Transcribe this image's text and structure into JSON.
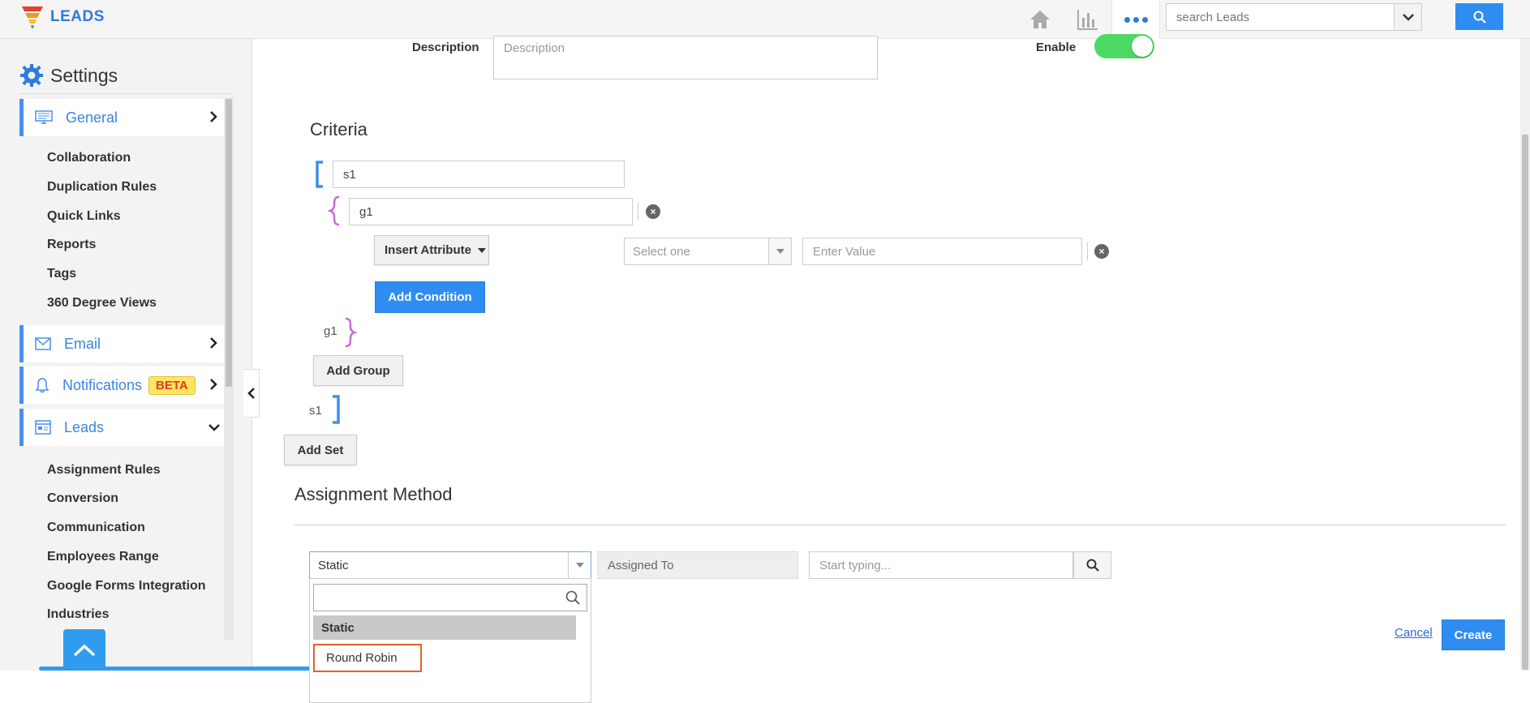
{
  "app": {
    "title": "LEADS"
  },
  "header": {
    "search_placeholder": "search Leads",
    "icons": [
      "home-icon",
      "chart-icon",
      "more-icon",
      "search-icon"
    ]
  },
  "sidebar": {
    "title": "Settings",
    "sections": [
      {
        "label": "General",
        "items": [
          "Collaboration",
          "Duplication Rules",
          "Quick Links",
          "Reports",
          "Tags",
          "360 Degree Views"
        ]
      },
      {
        "label": "Email"
      },
      {
        "label": "Notifications",
        "badge": "BETA"
      },
      {
        "label": "Leads",
        "items": [
          "Assignment Rules",
          "Conversion",
          "Communication",
          "Employees Range",
          "Google Forms Integration",
          "Industries"
        ]
      }
    ]
  },
  "form": {
    "description_label": "Description",
    "description_placeholder": "Description",
    "enable_label": "Enable",
    "enable_on": true
  },
  "criteria": {
    "title": "Criteria",
    "set_name": "s1",
    "group_name": "g1",
    "insert_attribute": "Insert Attribute",
    "select_placeholder": "Select one",
    "value_placeholder": "Enter Value",
    "add_condition": "Add Condition",
    "group_close_label": "g1",
    "add_group": "Add Group",
    "set_close_label": "s1",
    "add_set": "Add Set"
  },
  "assignment": {
    "title": "Assignment Method",
    "method_selected": "Static",
    "assigned_to_label": "Assigned To",
    "start_typing_placeholder": "Start typing...",
    "dropdown_options": [
      "Static",
      "Round Robin"
    ],
    "highlight_color": "#e0632a"
  },
  "actions": {
    "cancel": "Cancel",
    "create": "Create"
  },
  "colors": {
    "accent": "#2f8cf0",
    "set_bracket": "#3b8ff0",
    "group_brace": "#c86ad8",
    "toggle_on": "#4cd964"
  }
}
